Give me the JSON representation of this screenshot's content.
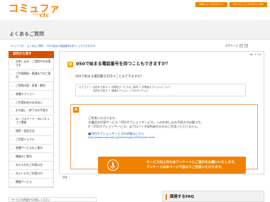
{
  "header": {
    "logo_main": "コミュファ",
    "logo_sub": "Powered by",
    "logo_ctc": "ctc",
    "btn_web_mail": "Web メールログイン",
    "btn_mypage": "MyコミュファログインMy"
  },
  "page_title": "よくあるご質問",
  "breadcrumb": {
    "items": [
      "コミュファ光",
      "よくあるご質問",
      "050で始まる電話番号を持つこともできますか？"
    ]
  },
  "font_size": {
    "label": "文字サイズ",
    "small": "小",
    "large": "大"
  },
  "sidebar": {
    "heading": "目的から探す",
    "items": [
      {
        "label": "お申し込み・ご契約中のお客さま",
        "sub": false
      },
      {
        "label": "ご利用開始・開通までのご案内",
        "sub": false
      },
      {
        "label": "ご契約内容・変更・解約",
        "sub": false
      },
      {
        "label": "各種オプション",
        "sub": false
      },
      {
        "label": "ご利用料金のお支払い",
        "sub": false
      },
      {
        "label": "お引越し・終了のお手続き",
        "sub": false
      },
      {
        "label": "ID・パスワード・Myコミュファ関連",
        "sub": false
      },
      {
        "label": "接続・設定方法",
        "sub": false
      },
      {
        "label": "ご利用トラブル",
        "sub": false
      },
      {
        "label": "各種サービスのご案内",
        "sub": false
      },
      {
        "label": "機器のご案内",
        "sub": false
      },
      {
        "label": "光でんわをご利用の方",
        "sub": false
      },
      {
        "label": "光テレビをご利用の方",
        "sub": false
      },
      {
        "label": "関連サービス",
        "sub": false
      }
    ]
  },
  "bottom_left": "サービスの内容からお探しください",
  "faq": {
    "pv": "No. 1 3 8",
    "q_badge": "Q",
    "question_title": "050で始まる電話番号を持つこともできますか？",
    "question_body": "050で始まる電話番号を持つこともできますか？",
    "category_label": "カテゴリー：",
    "category_row1": "目的から探す ＞ 光電話サービスのご案内 ＞ 光電話オプションについて",
    "category_row2": "目的から探す ＞ 各種オプション ＞ 050オプション",
    "a_badge": "A",
    "answer_lines": [
      "ご利用いただけます。",
      "光電話の付帯サービス「050オプションサービス」へのお申し込み手続きが必要です。",
      "※「050オプションサービス」はプロバイダ契約者の方のみご利用いただけません。"
    ],
    "link_text": "■050オプションサービスの詳細はこちら",
    "link_url": "http://www.commufa.jp/hikari/option/050/index.html",
    "survey_line1": "サービス向上のためアンケートにご協力をお願いいたします。",
    "survey_line2": "アンケートは本ページ下部よりご回答いただけます。"
  },
  "back_link": "戻る",
  "related": {
    "title": "関連するFAQ"
  }
}
